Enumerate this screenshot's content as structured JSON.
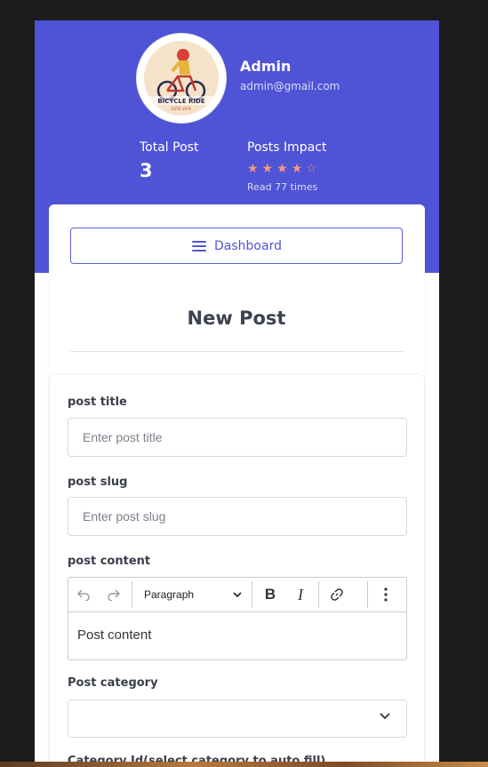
{
  "profile": {
    "name": "Admin",
    "email": "admin@gmail.com",
    "avatar_text": "BICYCLE RIDE",
    "avatar_subtext": "ESTD 1976"
  },
  "stats": {
    "total_post_label": "Total Post",
    "total_post_value": "3",
    "impact_label": "Posts Impact",
    "rating": 4,
    "rating_max": 5,
    "reads_text": "Read 77 times"
  },
  "nav": {
    "dashboard_label": "Dashboard"
  },
  "page": {
    "title": "New Post"
  },
  "form": {
    "title_label": "post title",
    "title_placeholder": "Enter post title",
    "slug_label": "post slug",
    "slug_placeholder": "Enter post slug",
    "content_label": "post content",
    "content_placeholder": "Post content",
    "paragraph_option": "Paragraph",
    "category_label": "Post category",
    "next_label_partial": "Category Id(select category to auto fill)"
  },
  "colors": {
    "brand": "#4f54d6",
    "star": "#f39a7e",
    "background": "#1c1c1c"
  }
}
